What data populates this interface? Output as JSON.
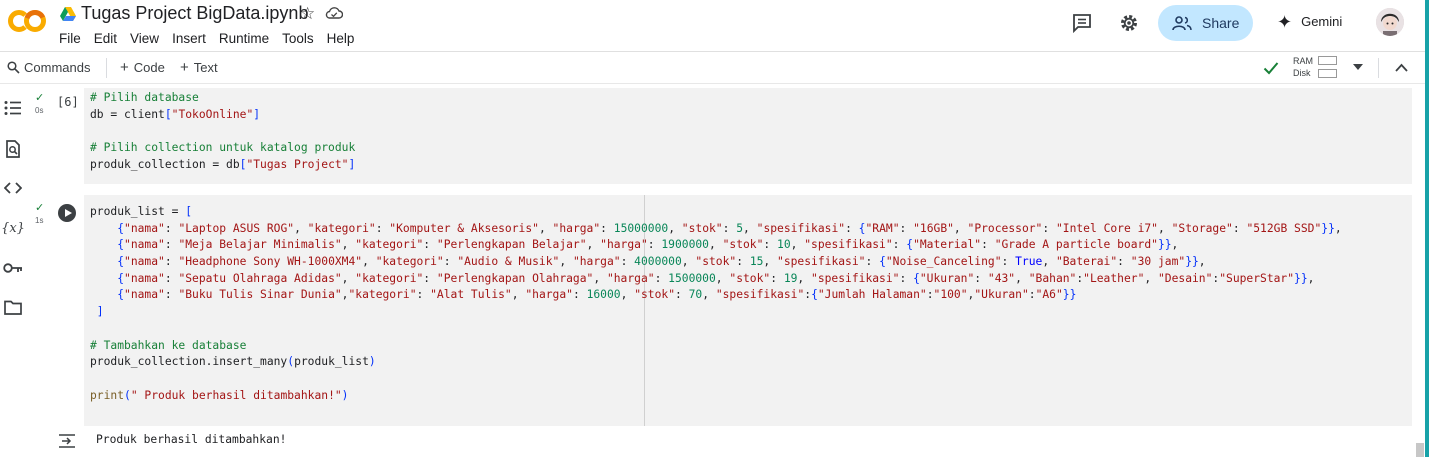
{
  "app": {
    "logo_text": "CO",
    "notebook_title": "Tugas Project BigData.ipynb"
  },
  "menu": [
    "File",
    "Edit",
    "View",
    "Insert",
    "Runtime",
    "Tools",
    "Help"
  ],
  "header": {
    "share_label": "Share",
    "gemini_label": "Gemini"
  },
  "toolbar": {
    "commands_label": "Commands",
    "code_label": "Code",
    "text_label": "Text",
    "ram_label": "RAM",
    "disk_label": "Disk"
  },
  "cells": [
    {
      "exec_count": "[6]",
      "duration": "0s",
      "lines": [
        [
          {
            "t": "# Pilih database",
            "c": "cm"
          }
        ],
        [
          {
            "t": "db = client",
            "c": ""
          },
          {
            "t": "[",
            "c": "br"
          },
          {
            "t": "\"TokoOnline\"",
            "c": "st"
          },
          {
            "t": "]",
            "c": "br"
          }
        ],
        [
          {
            "t": "",
            "c": ""
          }
        ],
        [
          {
            "t": "# Pilih collection untuk katalog produk",
            "c": "cm"
          }
        ],
        [
          {
            "t": "produk_collection = db",
            "c": ""
          },
          {
            "t": "[",
            "c": "br"
          },
          {
            "t": "\"Tugas Project\"",
            "c": "st"
          },
          {
            "t": "]",
            "c": "br"
          }
        ]
      ]
    },
    {
      "exec_count": "",
      "duration": "1s",
      "lines": [
        [
          {
            "t": "produk_list = ",
            "c": ""
          },
          {
            "t": "[",
            "c": "br"
          }
        ],
        [
          {
            "t": "    {",
            "c": "br"
          },
          {
            "t": "\"nama\"",
            "c": "st"
          },
          {
            "t": ": ",
            "c": ""
          },
          {
            "t": "\"Laptop ASUS ROG\"",
            "c": "st"
          },
          {
            "t": ", ",
            "c": ""
          },
          {
            "t": "\"kategori\"",
            "c": "st"
          },
          {
            "t": ": ",
            "c": ""
          },
          {
            "t": "\"Komputer & Aksesoris\"",
            "c": "st"
          },
          {
            "t": ", ",
            "c": ""
          },
          {
            "t": "\"harga\"",
            "c": "st"
          },
          {
            "t": ": ",
            "c": ""
          },
          {
            "t": "15000000",
            "c": "nm"
          },
          {
            "t": ", ",
            "c": ""
          },
          {
            "t": "\"stok\"",
            "c": "st"
          },
          {
            "t": ": ",
            "c": ""
          },
          {
            "t": "5",
            "c": "nm"
          },
          {
            "t": ", ",
            "c": ""
          },
          {
            "t": "\"spesifikasi\"",
            "c": "st"
          },
          {
            "t": ": ",
            "c": ""
          },
          {
            "t": "{",
            "c": "br"
          },
          {
            "t": "\"RAM\"",
            "c": "st"
          },
          {
            "t": ": ",
            "c": ""
          },
          {
            "t": "\"16GB\"",
            "c": "st"
          },
          {
            "t": ", ",
            "c": ""
          },
          {
            "t": "\"Processor\"",
            "c": "st"
          },
          {
            "t": ": ",
            "c": ""
          },
          {
            "t": "\"Intel Core i7\"",
            "c": "st"
          },
          {
            "t": ", ",
            "c": ""
          },
          {
            "t": "\"Storage\"",
            "c": "st"
          },
          {
            "t": ": ",
            "c": ""
          },
          {
            "t": "\"512GB SSD\"",
            "c": "st"
          },
          {
            "t": "}}",
            "c": "br"
          },
          {
            "t": ",",
            "c": ""
          }
        ],
        [
          {
            "t": "    {",
            "c": "br"
          },
          {
            "t": "\"nama\"",
            "c": "st"
          },
          {
            "t": ": ",
            "c": ""
          },
          {
            "t": "\"Meja Belajar Minimalis\"",
            "c": "st"
          },
          {
            "t": ", ",
            "c": ""
          },
          {
            "t": "\"kategori\"",
            "c": "st"
          },
          {
            "t": ": ",
            "c": ""
          },
          {
            "t": "\"Perlengkapan Belajar\"",
            "c": "st"
          },
          {
            "t": ", ",
            "c": ""
          },
          {
            "t": "\"harga\"",
            "c": "st"
          },
          {
            "t": ": ",
            "c": ""
          },
          {
            "t": "1900000",
            "c": "nm"
          },
          {
            "t": ", ",
            "c": ""
          },
          {
            "t": "\"stok\"",
            "c": "st"
          },
          {
            "t": ": ",
            "c": ""
          },
          {
            "t": "10",
            "c": "nm"
          },
          {
            "t": ", ",
            "c": ""
          },
          {
            "t": "\"spesifikasi\"",
            "c": "st"
          },
          {
            "t": ": ",
            "c": ""
          },
          {
            "t": "{",
            "c": "br"
          },
          {
            "t": "\"Material\"",
            "c": "st"
          },
          {
            "t": ": ",
            "c": ""
          },
          {
            "t": "\"Grade A particle board\"",
            "c": "st"
          },
          {
            "t": "}}",
            "c": "br"
          },
          {
            "t": ",",
            "c": ""
          }
        ],
        [
          {
            "t": "    {",
            "c": "br"
          },
          {
            "t": "\"nama\"",
            "c": "st"
          },
          {
            "t": ": ",
            "c": ""
          },
          {
            "t": "\"Headphone Sony WH-1000XM4\"",
            "c": "st"
          },
          {
            "t": ", ",
            "c": ""
          },
          {
            "t": "\"kategori\"",
            "c": "st"
          },
          {
            "t": ": ",
            "c": ""
          },
          {
            "t": "\"Audio & Musik\"",
            "c": "st"
          },
          {
            "t": ", ",
            "c": ""
          },
          {
            "t": "\"harga\"",
            "c": "st"
          },
          {
            "t": ": ",
            "c": ""
          },
          {
            "t": "4000000",
            "c": "nm"
          },
          {
            "t": ", ",
            "c": ""
          },
          {
            "t": "\"stok\"",
            "c": "st"
          },
          {
            "t": ": ",
            "c": ""
          },
          {
            "t": "15",
            "c": "nm"
          },
          {
            "t": ", ",
            "c": ""
          },
          {
            "t": "\"spesifikasi\"",
            "c": "st"
          },
          {
            "t": ": ",
            "c": ""
          },
          {
            "t": "{",
            "c": "br"
          },
          {
            "t": "\"Noise_Canceling\"",
            "c": "st"
          },
          {
            "t": ": ",
            "c": ""
          },
          {
            "t": "True",
            "c": "kw"
          },
          {
            "t": ", ",
            "c": ""
          },
          {
            "t": "\"Baterai\"",
            "c": "st"
          },
          {
            "t": ": ",
            "c": ""
          },
          {
            "t": "\"30 jam\"",
            "c": "st"
          },
          {
            "t": "}}",
            "c": "br"
          },
          {
            "t": ",",
            "c": ""
          }
        ],
        [
          {
            "t": "    {",
            "c": "br"
          },
          {
            "t": "\"nama\"",
            "c": "st"
          },
          {
            "t": ": ",
            "c": ""
          },
          {
            "t": "\"Sepatu Olahraga Adidas\"",
            "c": "st"
          },
          {
            "t": ", ",
            "c": ""
          },
          {
            "t": "\"kategori\"",
            "c": "st"
          },
          {
            "t": ": ",
            "c": ""
          },
          {
            "t": "\"Perlengkapan Olahraga\"",
            "c": "st"
          },
          {
            "t": ", ",
            "c": ""
          },
          {
            "t": "\"harga\"",
            "c": "st"
          },
          {
            "t": ": ",
            "c": ""
          },
          {
            "t": "1500000",
            "c": "nm"
          },
          {
            "t": ", ",
            "c": ""
          },
          {
            "t": "\"stok\"",
            "c": "st"
          },
          {
            "t": ": ",
            "c": ""
          },
          {
            "t": "19",
            "c": "nm"
          },
          {
            "t": ", ",
            "c": ""
          },
          {
            "t": "\"spesifikasi\"",
            "c": "st"
          },
          {
            "t": ": ",
            "c": ""
          },
          {
            "t": "{",
            "c": "br"
          },
          {
            "t": "\"Ukuran\"",
            "c": "st"
          },
          {
            "t": ": ",
            "c": ""
          },
          {
            "t": "\"43\"",
            "c": "st"
          },
          {
            "t": ", ",
            "c": ""
          },
          {
            "t": "\"Bahan\"",
            "c": "st"
          },
          {
            "t": ":",
            "c": ""
          },
          {
            "t": "\"Leather\"",
            "c": "st"
          },
          {
            "t": ", ",
            "c": ""
          },
          {
            "t": "\"Desain\"",
            "c": "st"
          },
          {
            "t": ":",
            "c": ""
          },
          {
            "t": "\"SuperStar\"",
            "c": "st"
          },
          {
            "t": "}}",
            "c": "br"
          },
          {
            "t": ",",
            "c": ""
          }
        ],
        [
          {
            "t": "    {",
            "c": "br"
          },
          {
            "t": "\"nama\"",
            "c": "st"
          },
          {
            "t": ": ",
            "c": ""
          },
          {
            "t": "\"Buku Tulis Sinar Dunia\"",
            "c": "st"
          },
          {
            "t": ",",
            "c": ""
          },
          {
            "t": "\"kategori\"",
            "c": "st"
          },
          {
            "t": ": ",
            "c": ""
          },
          {
            "t": "\"Alat Tulis\"",
            "c": "st"
          },
          {
            "t": ", ",
            "c": ""
          },
          {
            "t": "\"harga\"",
            "c": "st"
          },
          {
            "t": ": ",
            "c": ""
          },
          {
            "t": "16000",
            "c": "nm"
          },
          {
            "t": ", ",
            "c": ""
          },
          {
            "t": "\"stok\"",
            "c": "st"
          },
          {
            "t": ": ",
            "c": ""
          },
          {
            "t": "70",
            "c": "nm"
          },
          {
            "t": ", ",
            "c": ""
          },
          {
            "t": "\"spesifikasi\"",
            "c": "st"
          },
          {
            "t": ":",
            "c": ""
          },
          {
            "t": "{",
            "c": "br"
          },
          {
            "t": "\"Jumlah Halaman\"",
            "c": "st"
          },
          {
            "t": ":",
            "c": ""
          },
          {
            "t": "\"100\"",
            "c": "st"
          },
          {
            "t": ",",
            "c": ""
          },
          {
            "t": "\"Ukuran\"",
            "c": "st"
          },
          {
            "t": ":",
            "c": ""
          },
          {
            "t": "\"A6\"",
            "c": "st"
          },
          {
            "t": "}}",
            "c": "br"
          }
        ],
        [
          {
            "t": " ]",
            "c": "br"
          }
        ],
        [
          {
            "t": "",
            "c": ""
          }
        ],
        [
          {
            "t": "# Tambahkan ke database",
            "c": "cm"
          }
        ],
        [
          {
            "t": "produk_collection.insert_many",
            "c": ""
          },
          {
            "t": "(",
            "c": "br"
          },
          {
            "t": "produk_list",
            "c": ""
          },
          {
            "t": ")",
            "c": "br"
          }
        ],
        [
          {
            "t": "",
            "c": ""
          }
        ],
        [
          {
            "t": "print",
            "c": "fn"
          },
          {
            "t": "(",
            "c": "br"
          },
          {
            "t": "\" Produk berhasil ditambahkan!\"",
            "c": "st"
          },
          {
            "t": ")",
            "c": "br"
          }
        ]
      ]
    }
  ],
  "output": {
    "text": "Produk berhasil ditambahkan!"
  }
}
